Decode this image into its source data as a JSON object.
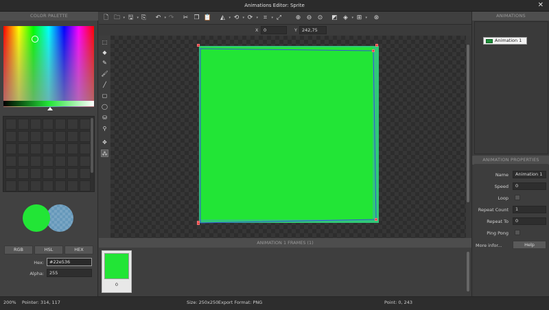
{
  "window": {
    "title": "Animations Editor: Sprite"
  },
  "color_palette": {
    "header": "COLOR PALETTE",
    "primary_color": "#22e536",
    "secondary_color": "#6699bb",
    "modes": [
      "RGB",
      "HSL",
      "HEX"
    ],
    "hex_label": "Hex:",
    "hex_value": "#22e536",
    "alpha_label": "Alpha:",
    "alpha_value": "255"
  },
  "toolbar": {
    "icons": [
      "new-file-icon",
      "open-folder-icon",
      "save-icon",
      "export-icon",
      "undo-icon",
      "redo-icon",
      "cut-icon",
      "copy-icon",
      "paste-icon",
      "flip-icon",
      "rotate-left-icon",
      "rotate-right-icon",
      "crop-icon",
      "resize-icon",
      "zoom-in-icon",
      "zoom-out-icon",
      "zoom-reset-icon",
      "background-icon",
      "layers-icon",
      "grid-icon",
      "play-icon"
    ]
  },
  "coords": {
    "x_label": "X",
    "x_value": "0",
    "y_label": "Y",
    "y_value": "242,75"
  },
  "frames": {
    "header": "ANIMATION 1 FRAMES (1)",
    "items": [
      {
        "index": "0"
      }
    ]
  },
  "animations": {
    "header": "ANIMATIONS",
    "items": [
      {
        "label": "Animation 1"
      }
    ]
  },
  "properties": {
    "header": "ANIMATION PROPERTIES",
    "name_label": "Name",
    "name_value": "Animation 1",
    "speed_label": "Speed",
    "speed_value": "0",
    "loop_label": "Loop",
    "repeat_count_label": "Repeat Count",
    "repeat_count_value": "1",
    "repeat_to_label": "Repeat To",
    "repeat_to_value": "0",
    "ping_pong_label": "Ping Pong",
    "more_info_label": "More infor...",
    "help_label": "Help"
  },
  "status": {
    "zoom": "200%",
    "pointer": "Pointer: 314, 117",
    "size": "Size: 250x250",
    "export_format": "Export Format: PNG",
    "point": "Point: 0, 243"
  }
}
